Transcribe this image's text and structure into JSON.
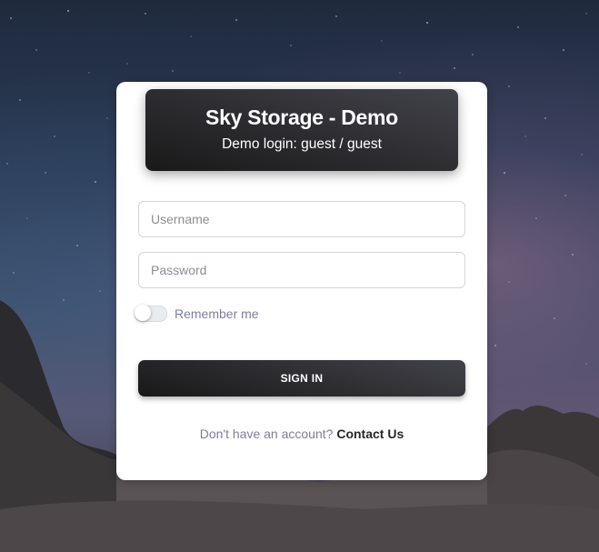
{
  "header": {
    "title": "Sky Storage - Demo",
    "subtitle": "Demo login: guest / guest"
  },
  "form": {
    "username_placeholder": "Username",
    "username_value": "",
    "password_placeholder": "Password",
    "password_value": "",
    "remember_label": "Remember me",
    "remember_checked": false,
    "signin_label": "SIGN IN"
  },
  "footer": {
    "prompt": "Don't have an account?",
    "link_label": "Contact Us"
  },
  "colors": {
    "header_gradient_start": "#42424a",
    "header_gradient_end": "#191919",
    "muted_text": "#7b809a",
    "link_text": "#262626"
  },
  "icons": {
    "background": "night-sky-rocks-image"
  }
}
